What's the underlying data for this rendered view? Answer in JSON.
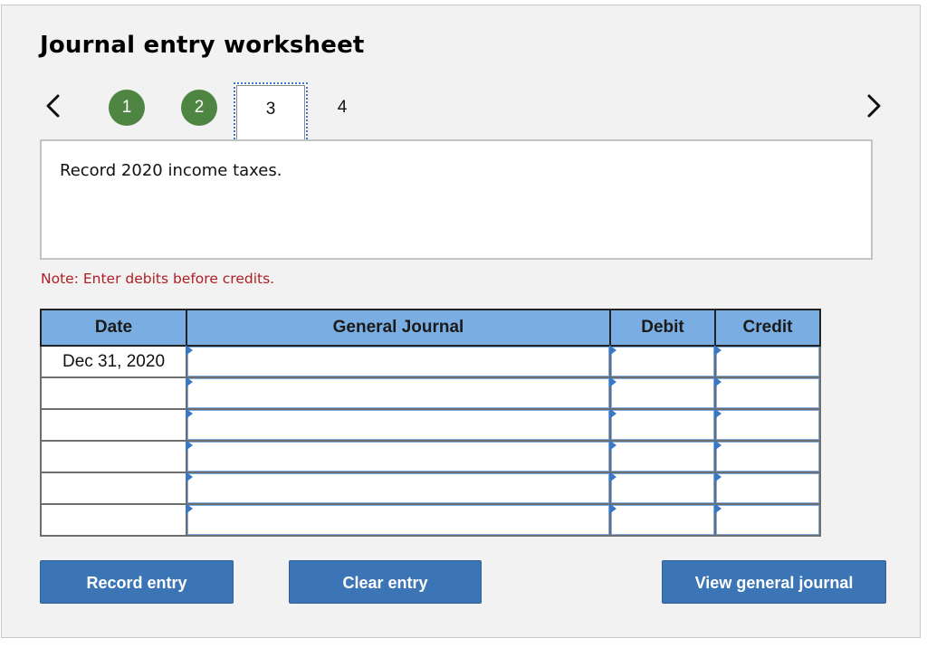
{
  "header": {
    "title": "Journal entry worksheet"
  },
  "navigation": {
    "prev_icon": "chevron-left-icon",
    "next_icon": "chevron-right-icon",
    "steps": [
      {
        "label": "1",
        "state": "completed"
      },
      {
        "label": "2",
        "state": "completed"
      },
      {
        "label": "3",
        "state": "current"
      },
      {
        "label": "4",
        "state": "upcoming"
      }
    ]
  },
  "prompt": {
    "text": "Record 2020 income taxes."
  },
  "note": {
    "text": "Note: Enter debits before credits."
  },
  "journal_table": {
    "columns": [
      "Date",
      "General Journal",
      "Debit",
      "Credit"
    ],
    "rows": [
      {
        "date": "Dec 31, 2020",
        "account": "",
        "debit": "",
        "credit": ""
      },
      {
        "date": "",
        "account": "",
        "debit": "",
        "credit": ""
      },
      {
        "date": "",
        "account": "",
        "debit": "",
        "credit": ""
      },
      {
        "date": "",
        "account": "",
        "debit": "",
        "credit": ""
      },
      {
        "date": "",
        "account": "",
        "debit": "",
        "credit": ""
      },
      {
        "date": "",
        "account": "",
        "debit": "",
        "credit": ""
      }
    ]
  },
  "buttons": {
    "record": "Record entry",
    "clear": "Clear entry",
    "view": "View general journal"
  },
  "colors": {
    "step_completed": "#4e8543",
    "header_bg": "#7aaee3",
    "button_bg": "#3c75b6",
    "note_text": "#b01e23",
    "focus_outline": "#3a78c3"
  }
}
